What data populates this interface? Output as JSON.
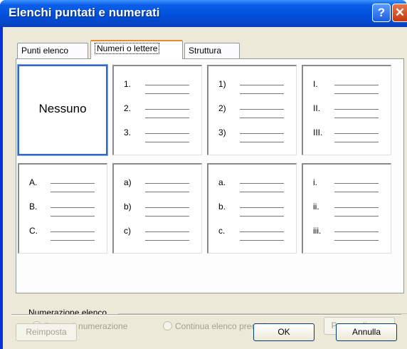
{
  "window": {
    "title": "Elenchi puntati e numerati",
    "help_glyph": "?",
    "close_glyph": "✕"
  },
  "tabs": [
    {
      "label": "Punti elenco",
      "selected": false
    },
    {
      "label": "Numeri o lettere",
      "selected": true
    },
    {
      "label": "Struttura",
      "selected": false
    }
  ],
  "gallery": {
    "none_label": "Nessuno",
    "styles": [
      {
        "id": "none",
        "selected": true,
        "labels": []
      },
      {
        "id": "numbers-period",
        "selected": false,
        "labels": [
          "1.",
          "2.",
          "3."
        ]
      },
      {
        "id": "numbers-paren",
        "selected": false,
        "labels": [
          "1)",
          "2)",
          "3)"
        ]
      },
      {
        "id": "upper-roman",
        "selected": false,
        "labels": [
          "I.",
          "II.",
          "III."
        ]
      },
      {
        "id": "upper-alpha",
        "selected": false,
        "labels": [
          "A.",
          "B.",
          "C."
        ]
      },
      {
        "id": "lower-alpha-paren",
        "selected": false,
        "labels": [
          "a)",
          "b)",
          "c)"
        ]
      },
      {
        "id": "lower-alpha-period",
        "selected": false,
        "labels": [
          "a.",
          "b.",
          "c."
        ]
      },
      {
        "id": "lower-roman",
        "selected": false,
        "labels": [
          "i.",
          "ii.",
          "iii."
        ]
      }
    ]
  },
  "numbering": {
    "section_label": "Numerazione elenco",
    "restart_label": "Riprendi numerazione",
    "restart_checked": true,
    "continue_label": "Continua elenco precedente",
    "continue_checked": false,
    "customize_label": "Personalizza...",
    "enabled": false
  },
  "footer": {
    "reset_label": "Reimposta",
    "ok_label": "OK",
    "cancel_label": "Annulla"
  },
  "colors": {
    "titlebar": "#0050dc",
    "selection_border": "#316ac5",
    "tab_highlight": "#e68b2c",
    "dialog_face": "#ece9d8"
  }
}
